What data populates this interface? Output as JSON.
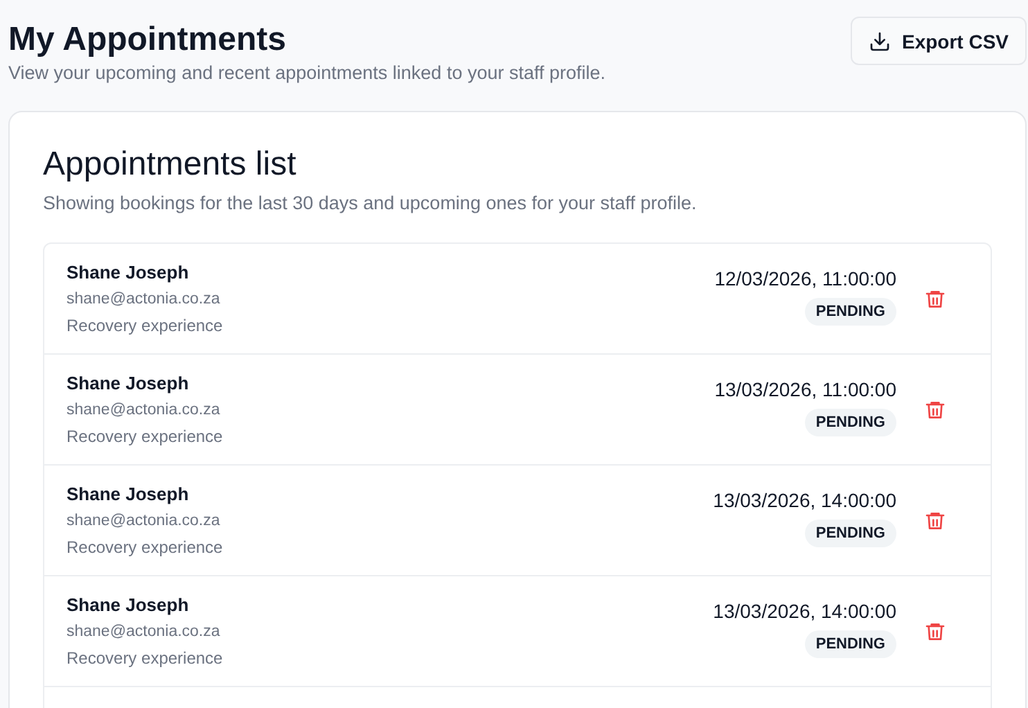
{
  "header": {
    "title": "My Appointments",
    "subtitle": "View your upcoming and recent appointments linked to your staff profile.",
    "export_button": "Export CSV"
  },
  "card": {
    "title": "Appointments list",
    "subtitle": "Showing bookings for the last 30 days and upcoming ones for your staff profile.",
    "appointments": [
      {
        "name": "Shane Joseph",
        "email": "shane@actonia.co.za",
        "service": "Recovery experience",
        "datetime": "12/03/2026, 11:00:00",
        "status": "PENDING"
      },
      {
        "name": "Shane Joseph",
        "email": "shane@actonia.co.za",
        "service": "Recovery experience",
        "datetime": "13/03/2026, 11:00:00",
        "status": "PENDING"
      },
      {
        "name": "Shane Joseph",
        "email": "shane@actonia.co.za",
        "service": "Recovery experience",
        "datetime": "13/03/2026, 14:00:00",
        "status": "PENDING"
      },
      {
        "name": "Shane Joseph",
        "email": "shane@actonia.co.za",
        "service": "Recovery experience",
        "datetime": "13/03/2026, 14:00:00",
        "status": "PENDING"
      }
    ]
  }
}
